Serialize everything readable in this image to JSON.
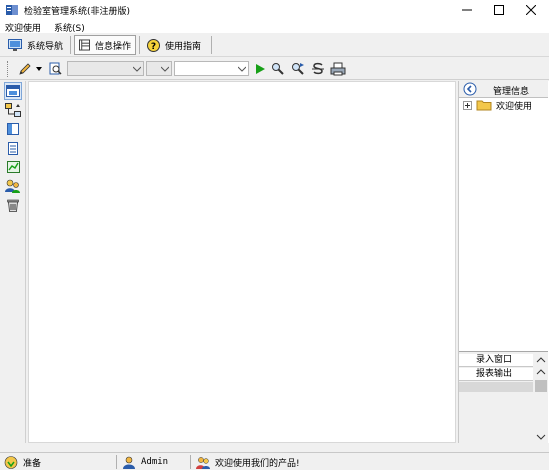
{
  "window": {
    "title": "检验室管理系统(非注册版)",
    "controls": [
      "minimize",
      "maximize",
      "close"
    ]
  },
  "menu": [
    "欢迎使用",
    "系统(S)"
  ],
  "nav_tabs": [
    {
      "label": "系统导航",
      "icon": "monitor-icon",
      "active": false
    },
    {
      "label": "信息操作",
      "icon": "form-icon",
      "active": true
    },
    {
      "label": "使用指南",
      "icon": "help-icon",
      "active": false
    }
  ],
  "toolbar": {
    "icons": [
      "pencil-icon",
      "dropdown-arrow-icon",
      "search-page-icon",
      "run-icon",
      "find-icon",
      "find-next-icon",
      "replace-icon",
      "print-icon"
    ],
    "combos": [
      "",
      "",
      ""
    ]
  },
  "left_strip_icons": [
    "window-icon",
    "diagram-icon",
    "panel-icon",
    "document-icon",
    "chart-icon",
    "users-icon",
    "trash-icon"
  ],
  "right_panel": {
    "header": "管理信息",
    "tree_root": "欢迎使用",
    "items": [
      "录入窗口",
      "报表输出"
    ]
  },
  "status": {
    "state": "准备",
    "user": "Admin",
    "message": "欢迎使用我们的产品!"
  },
  "colors": {
    "run_green": "#17a017",
    "folder_yellow": "#f3c74a",
    "accent_blue": "#2a5caa"
  }
}
